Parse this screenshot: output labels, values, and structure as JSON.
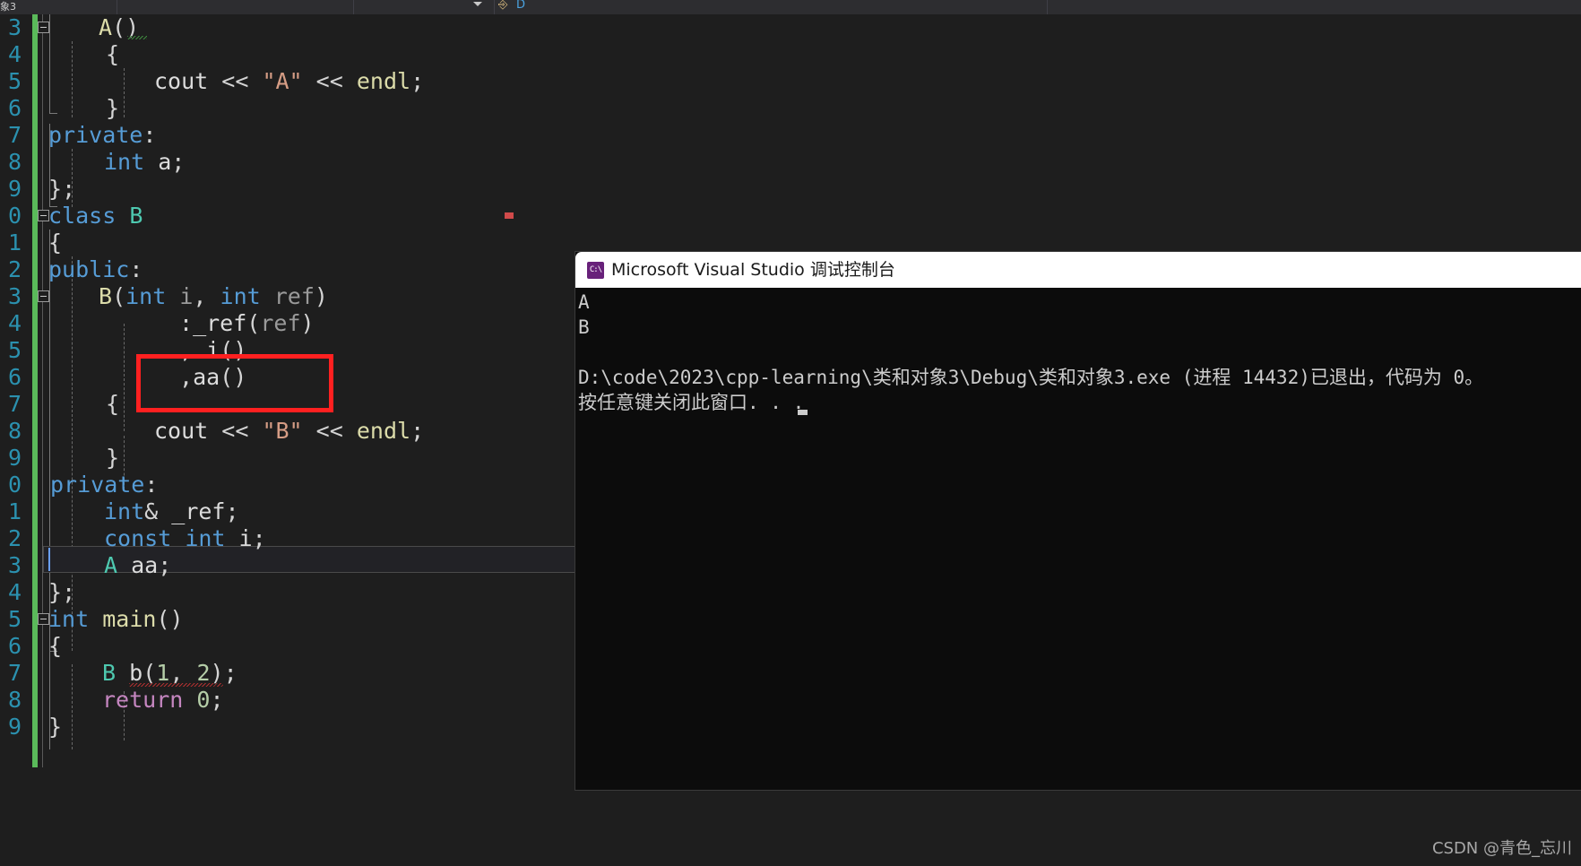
{
  "window": {
    "app": "Microsoft Visual Studio",
    "theme": "dark"
  },
  "toolbar": {
    "left_fragment": "象3",
    "glyph_fragment": "D"
  },
  "editor": {
    "language": "C++",
    "line_numbers": [
      "3",
      "4",
      "5",
      "6",
      "7",
      "8",
      "9",
      "0",
      "1",
      "2",
      "3",
      "4",
      "5",
      "6",
      "7",
      "8",
      "9",
      "0",
      "1",
      "2",
      "3",
      "4",
      "5",
      "6",
      "7",
      "8",
      "9"
    ],
    "lines": [
      {
        "n": "3",
        "text": "    A()"
      },
      {
        "n": "4",
        "text": "    {"
      },
      {
        "n": "5",
        "text": "        cout << \"A\" << endl;"
      },
      {
        "n": "6",
        "text": "    }"
      },
      {
        "n": "7",
        "text": "private:"
      },
      {
        "n": "8",
        "text": "    int a;"
      },
      {
        "n": "9",
        "text": "};"
      },
      {
        "n": "0",
        "text": "class B"
      },
      {
        "n": "1",
        "text": "{"
      },
      {
        "n": "2",
        "text": "public:"
      },
      {
        "n": "3",
        "text": "    B(int i, int ref)"
      },
      {
        "n": "4",
        "text": "        :_ref(ref)"
      },
      {
        "n": "5",
        "text": "        , i()"
      },
      {
        "n": "6",
        "text": "        ,aa()"
      },
      {
        "n": "7",
        "text": "    {"
      },
      {
        "n": "8",
        "text": "        cout << \"B\" << endl;"
      },
      {
        "n": "9",
        "text": "    }"
      },
      {
        "n": "0",
        "text": "private:"
      },
      {
        "n": "1",
        "text": "    int& _ref;"
      },
      {
        "n": "2",
        "text": "    const int i;"
      },
      {
        "n": "3",
        "text": "    A aa;"
      },
      {
        "n": "4",
        "text": "};"
      },
      {
        "n": "5",
        "text": "int main()"
      },
      {
        "n": "6",
        "text": "{"
      },
      {
        "n": "7",
        "text": "    B b(1, 2);"
      },
      {
        "n": "8",
        "text": "    return 0;"
      },
      {
        "n": "9",
        "text": "}"
      }
    ],
    "current_line_text": "private:",
    "annotation": {
      "shape": "rectangle",
      "color": "#ff2020",
      "covers": [
        "        , i()",
        "        ,aa()"
      ]
    }
  },
  "console": {
    "title": "Microsoft Visual Studio 调试控制台",
    "icon": "console-app-icon",
    "output": [
      "A",
      "B",
      "",
      "D:\\code\\2023\\cpp-learning\\类和对象3\\Debug\\类和对象3.exe (进程 14432)已退出，代码为 0。",
      "按任意键关闭此窗口. . ."
    ],
    "process_id": "14432",
    "exit_code": "0"
  },
  "watermark": {
    "text": "CSDN @青色_忘川"
  }
}
